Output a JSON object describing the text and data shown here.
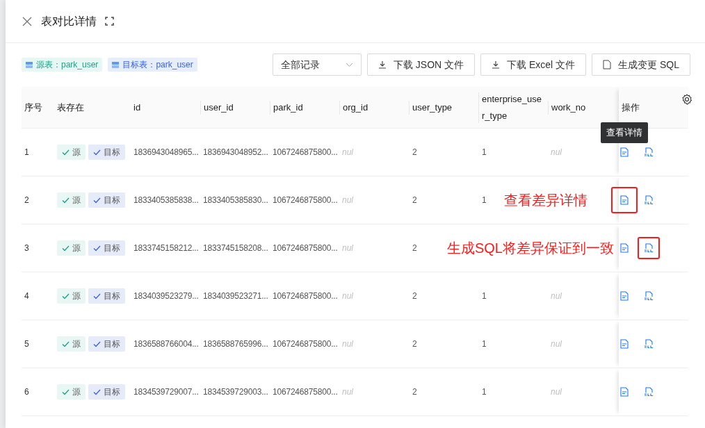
{
  "dialog": {
    "title": "表对比详情"
  },
  "source_tags": [
    {
      "kind": "source",
      "label": "源表：park_user"
    },
    {
      "kind": "target",
      "label": "目标表：park_user"
    }
  ],
  "toolbar": {
    "filter": {
      "value": "全部记录"
    },
    "buttons": [
      {
        "kind": "download",
        "label": "下载 JSON 文件"
      },
      {
        "kind": "download",
        "label": "下载 Excel 文件"
      },
      {
        "kind": "sql",
        "label": "生成变更 SQL"
      }
    ]
  },
  "table": {
    "columns": [
      "序号",
      "表存在",
      "id",
      "user_id",
      "park_id",
      "org_id",
      "user_type",
      "enterprise_user_type",
      "work_no",
      "操作"
    ],
    "tooltip": "查看详情",
    "rows": [
      {
        "cells": [
          {
            "kind": "value",
            "text": "1"
          },
          {
            "kind": "exists",
            "tags": [
              {
                "kind": "source",
                "label": "源"
              },
              {
                "kind": "target",
                "label": "目标"
              }
            ]
          },
          {
            "kind": "value",
            "text": "1836943048965..."
          },
          {
            "kind": "value",
            "text": "1836943048952..."
          },
          {
            "kind": "value",
            "text": "1067246875800..."
          },
          {
            "kind": "null",
            "text": "nul"
          },
          {
            "kind": "value",
            "text": "2"
          },
          {
            "kind": "value",
            "text": "1"
          },
          {
            "kind": "null",
            "text": "nul"
          },
          {
            "kind": "actions",
            "detail_marked": false,
            "sql_marked": false
          }
        ]
      },
      {
        "cells": [
          {
            "kind": "value",
            "text": "2"
          },
          {
            "kind": "exists",
            "tags": [
              {
                "kind": "source",
                "label": "源"
              },
              {
                "kind": "target",
                "label": "目标"
              }
            ]
          },
          {
            "kind": "value",
            "text": "1833405385838..."
          },
          {
            "kind": "value",
            "text": "1833405385830..."
          },
          {
            "kind": "value",
            "text": "1067246875800..."
          },
          {
            "kind": "null",
            "text": "nul"
          },
          {
            "kind": "value",
            "text": "2"
          },
          {
            "kind": "value",
            "text": "1"
          },
          {
            "kind": "hidden"
          },
          {
            "kind": "actions",
            "detail_marked": true,
            "sql_marked": false,
            "annotation": "查看差异详情"
          }
        ]
      },
      {
        "cells": [
          {
            "kind": "value",
            "text": "3"
          },
          {
            "kind": "exists",
            "tags": [
              {
                "kind": "source",
                "label": "源"
              },
              {
                "kind": "target",
                "label": "目标"
              }
            ]
          },
          {
            "kind": "value",
            "text": "1833745158212..."
          },
          {
            "kind": "value",
            "text": "1833745158208..."
          },
          {
            "kind": "value",
            "text": "1067246875800..."
          },
          {
            "kind": "null",
            "text": "nul"
          },
          {
            "kind": "value",
            "text": "2"
          },
          {
            "kind": "hidden"
          },
          {
            "kind": "hidden"
          },
          {
            "kind": "actions",
            "detail_marked": false,
            "sql_marked": true,
            "annotation": "生成SQL将差异保证到一致"
          }
        ]
      },
      {
        "cells": [
          {
            "kind": "value",
            "text": "4"
          },
          {
            "kind": "exists",
            "tags": [
              {
                "kind": "source",
                "label": "源"
              },
              {
                "kind": "target",
                "label": "目标"
              }
            ]
          },
          {
            "kind": "value",
            "text": "1834039523279..."
          },
          {
            "kind": "value",
            "text": "1834039523271..."
          },
          {
            "kind": "value",
            "text": "1067246875800..."
          },
          {
            "kind": "null",
            "text": "nul"
          },
          {
            "kind": "value",
            "text": "2"
          },
          {
            "kind": "value",
            "text": "1"
          },
          {
            "kind": "null",
            "text": "nul"
          },
          {
            "kind": "actions",
            "detail_marked": false,
            "sql_marked": false
          }
        ]
      },
      {
        "cells": [
          {
            "kind": "value",
            "text": "5"
          },
          {
            "kind": "exists",
            "tags": [
              {
                "kind": "source",
                "label": "源"
              },
              {
                "kind": "target",
                "label": "目标"
              }
            ]
          },
          {
            "kind": "value",
            "text": "1836588766004..."
          },
          {
            "kind": "value",
            "text": "1836588765996..."
          },
          {
            "kind": "value",
            "text": "1067246875800..."
          },
          {
            "kind": "null",
            "text": "nul"
          },
          {
            "kind": "value",
            "text": "2"
          },
          {
            "kind": "value",
            "text": "1"
          },
          {
            "kind": "null",
            "text": "nul"
          },
          {
            "kind": "actions",
            "detail_marked": false,
            "sql_marked": false
          }
        ]
      },
      {
        "cells": [
          {
            "kind": "value",
            "text": "6"
          },
          {
            "kind": "exists",
            "tags": [
              {
                "kind": "source",
                "label": "源"
              },
              {
                "kind": "target",
                "label": "目标"
              }
            ]
          },
          {
            "kind": "value",
            "text": "1834539729007..."
          },
          {
            "kind": "value",
            "text": "1834539729003..."
          },
          {
            "kind": "value",
            "text": "1067246875800..."
          },
          {
            "kind": "null",
            "text": "nul"
          },
          {
            "kind": "value",
            "text": "2"
          },
          {
            "kind": "value",
            "text": "1"
          },
          {
            "kind": "null",
            "text": "nul"
          },
          {
            "kind": "actions",
            "detail_marked": false,
            "sql_marked": false
          }
        ]
      }
    ]
  }
}
